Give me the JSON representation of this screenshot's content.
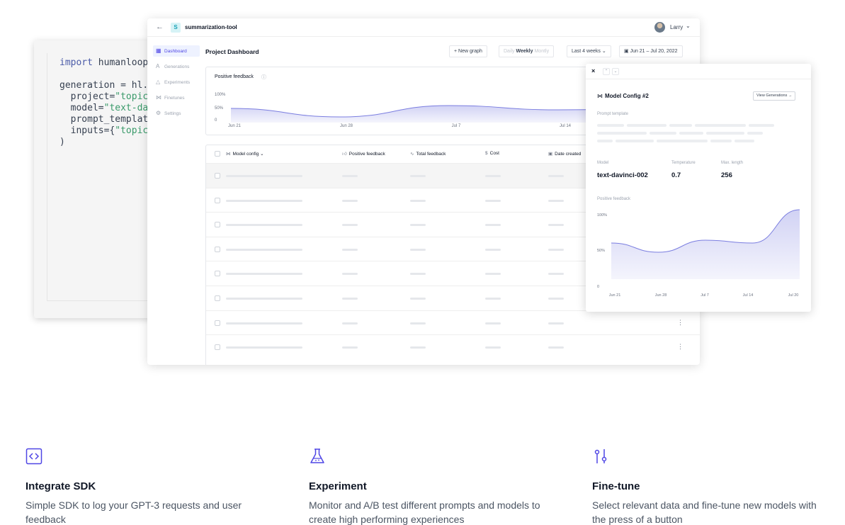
{
  "code": {
    "line1_kw": "import",
    "line1_rest": " humanloop",
    "line2": "generation = hl.",
    "line3_key": "  project=",
    "line3_str": "\"topic",
    "line4_key": "  model=",
    "line4_str": "\"text-da",
    "line5": "  prompt_templat",
    "line6_key": "  inputs={",
    "line6_str": "\"topic",
    "line7": ")"
  },
  "topbar": {
    "project_badge": "S",
    "project_name": "summarization-tool",
    "user_name": "Larry"
  },
  "sidebar": {
    "items": [
      {
        "label": "Dashboard",
        "icon": "grid-icon"
      },
      {
        "label": "Generations",
        "icon": "text-icon"
      },
      {
        "label": "Experiments",
        "icon": "flask-icon"
      },
      {
        "label": "Finetunes",
        "icon": "model-icon"
      },
      {
        "label": "Settings",
        "icon": "gear-icon"
      }
    ]
  },
  "header": {
    "title": "Project Dashboard",
    "new_graph": "New graph",
    "period": {
      "daily": "Daily",
      "weekly": "Weekly",
      "monthly": "Montly"
    },
    "range": "Last 4 weeks",
    "date_range": "Jun 21 – Jul 20, 2022"
  },
  "chart_data": [
    {
      "type": "area",
      "title": "Positive feedback",
      "y_tick_labels": [
        "100%",
        "50%",
        "0"
      ],
      "x_tick_labels": [
        "Jun 21",
        "Jun 28",
        "Jul 7",
        "Jul 14"
      ],
      "x": [
        "Jun 21",
        "Jun 28",
        "Jul 7",
        "Jul 14",
        "Jul 20"
      ],
      "values": [
        50,
        20,
        60,
        45,
        50
      ],
      "ylim": [
        0,
        100
      ],
      "color": "#7b7ee0"
    },
    {
      "type": "area",
      "title": "Positive feedback",
      "y_tick_labels": [
        "100%",
        "50%",
        "0"
      ],
      "x_tick_labels": [
        "Jun 21",
        "Jun 28",
        "Jul 7",
        "Jul 14",
        "Jul 20"
      ],
      "x": [
        "Jun 21",
        "Jun 28",
        "Jul 7",
        "Jul 14",
        "Jul 20"
      ],
      "values": [
        51,
        38,
        55,
        51,
        98
      ],
      "ylim": [
        0,
        100
      ],
      "color": "#7b7ee0"
    }
  ],
  "table": {
    "headers": [
      "Model config",
      "Positive feedback",
      "Total feedback",
      "Cost",
      "Date created"
    ],
    "row_count": 8
  },
  "model_config": {
    "title": "Model Config #2",
    "view_button": "View Generations →",
    "prompt_label": "Prompt template",
    "fields": [
      {
        "label": "Model",
        "value": "text-davinci-002"
      },
      {
        "label": "Temperature",
        "value": "0.7"
      },
      {
        "label": "Max. length",
        "value": "256"
      }
    ],
    "chart_label": "Positive feedback"
  },
  "features": [
    {
      "title": "Integrate SDK",
      "desc": "Simple SDK to log your GPT-3 requests and user feedback",
      "icon": "code-icon"
    },
    {
      "title": "Experiment",
      "desc": "Monitor and A/B test different prompts and models to create high performing experiences",
      "icon": "flask-icon"
    },
    {
      "title": "Fine-tune",
      "desc": "Select relevant data and fine-tune new models with the press of a button",
      "icon": "sliders-icon"
    }
  ]
}
